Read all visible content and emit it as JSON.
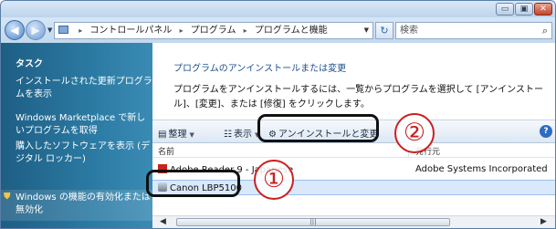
{
  "titlebar": {
    "controls": {
      "minimize": "▭",
      "maximize": "▣",
      "close": "✕"
    }
  },
  "addressbar": {
    "back": "◀",
    "forward": "▶",
    "dropdown": "▼",
    "separator": "▸",
    "crumbs": [
      "コントロールパネル",
      "プログラム",
      "プログラムと機能"
    ],
    "refresh": "↻",
    "search_placeholder": "検索",
    "search_icon": "⌕"
  },
  "taskpane": {
    "heading": "タスク",
    "links": [
      "インストールされた更新プログラムを表示",
      "Windows Marketplace で新しいプログラムを取得",
      "購入したソフトウェアを表示 (デジタル ロッカー)",
      "Windows の機能の有効化または無効化"
    ]
  },
  "main": {
    "title": "プログラムのアンインストールまたは変更",
    "description": "プログラムをアンインストールするには、一覧からプログラムを選択して [アンインストール]、[変更]、または [修復] をクリックします。"
  },
  "toolbar": {
    "organize": "整理",
    "views": "表示",
    "uninstall": "アンインストールと変更",
    "help": "?"
  },
  "columns": {
    "name": "名前",
    "publisher": "発行元"
  },
  "programs": [
    {
      "name": "Adobe Reader 9 - Japanese",
      "publisher": "Adobe Systems Incorporated"
    },
    {
      "name": "Canon LBP5100",
      "publisher": ""
    }
  ],
  "scrollbar": {
    "left": "◀",
    "thumb": "|||",
    "right": "▶"
  },
  "callouts": {
    "one": "①",
    "two": "②"
  },
  "colors": {
    "accent": "#1e4e8c",
    "taskpane": "#2b7aa3",
    "selection": "#d9e8fb",
    "callout": "#cc1f1f"
  }
}
